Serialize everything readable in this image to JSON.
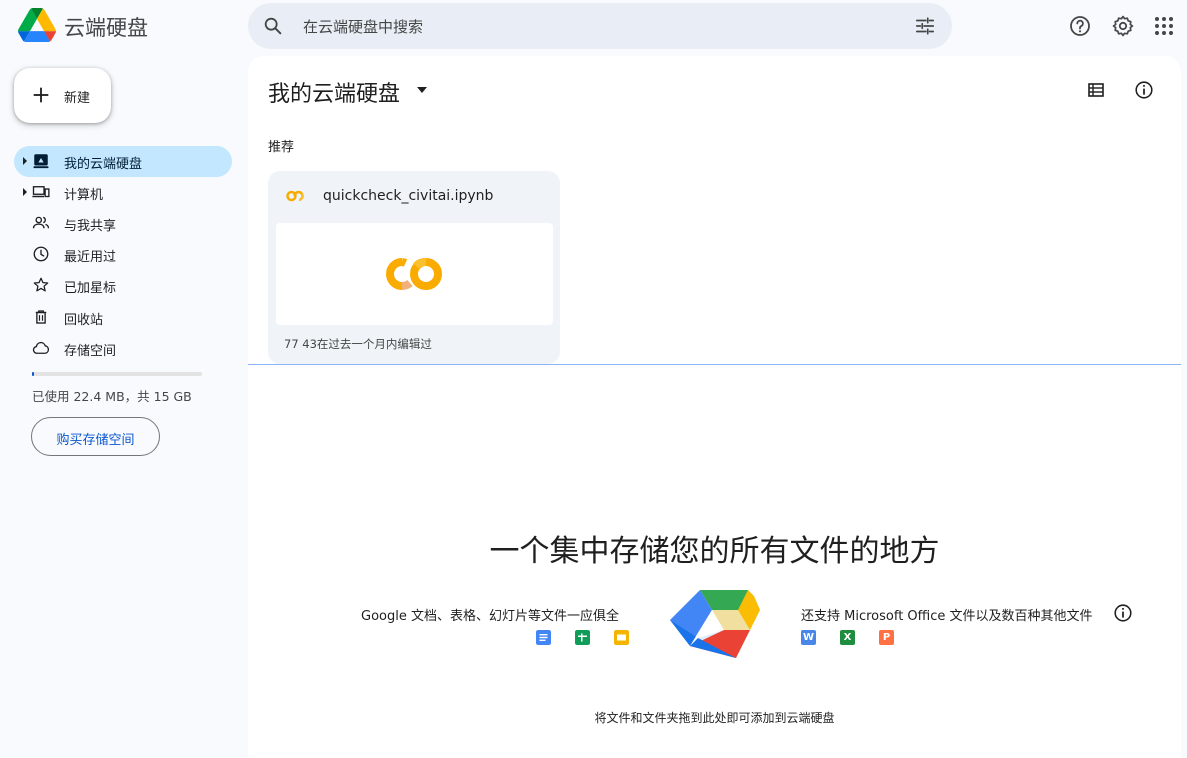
{
  "header": {
    "app_title": "云端硬盘",
    "search_placeholder": "在云端硬盘中搜索",
    "icons": [
      "drive-logo",
      "search-icon",
      "filter-icon",
      "help-icon",
      "settings-icon",
      "apps-icon"
    ]
  },
  "sidebar": {
    "new_label": "新建",
    "items": [
      {
        "label": "我的云端硬盘",
        "icon": "my-drive-icon",
        "expandable": true,
        "active": true
      },
      {
        "label": "计算机",
        "icon": "computer-icon",
        "expandable": true,
        "active": false
      },
      {
        "label": "与我共享",
        "icon": "shared-icon",
        "expandable": false,
        "active": false
      },
      {
        "label": "最近用过",
        "icon": "clock-icon",
        "expandable": false,
        "active": false
      },
      {
        "label": "已加星标",
        "icon": "star-icon",
        "expandable": false,
        "active": false
      },
      {
        "label": "回收站",
        "icon": "trash-icon",
        "expandable": false,
        "active": false
      },
      {
        "label": "存储空间",
        "icon": "cloud-icon",
        "expandable": false,
        "active": false
      }
    ],
    "storage_text": "已使用 22.4 MB，共 15 GB",
    "storage_used_fraction": 0.0015,
    "buy_label": "购买存储空间"
  },
  "main": {
    "title": "我的云端硬盘",
    "suggested_label": "推荐",
    "card": {
      "file_name": "quickcheck_civitai.ipynb",
      "meta": "77 43在过去一个月内编辑过"
    },
    "empty": {
      "title": "一个集中存储您的所有文件的地方",
      "left_text": "Google 文档、表格、幻灯片等文件一应俱全",
      "right_text": "还支持 Microsoft Office 文件以及数百种其他文件",
      "google_apps": [
        {
          "name": "docs-icon",
          "color": "#4285f4"
        },
        {
          "name": "sheets-icon",
          "color": "#0f9d58"
        },
        {
          "name": "slides-icon",
          "color": "#f4b400"
        }
      ],
      "office_apps": [
        {
          "letter": "W",
          "name": "word-icon",
          "color": "#4a86e8"
        },
        {
          "letter": "X",
          "name": "excel-icon",
          "color": "#1e8e3e"
        },
        {
          "letter": "P",
          "name": "powerpoint-icon",
          "color": "#ff7043"
        }
      ],
      "drop_hint": "将文件和文件夹拖到此处即可添加到云端硬盘"
    }
  },
  "colors": {
    "accent": "#0b57d0",
    "active_nav_bg": "#c2e7ff",
    "search_bg": "#e9eef6",
    "page_bg": "#f8fafd"
  }
}
